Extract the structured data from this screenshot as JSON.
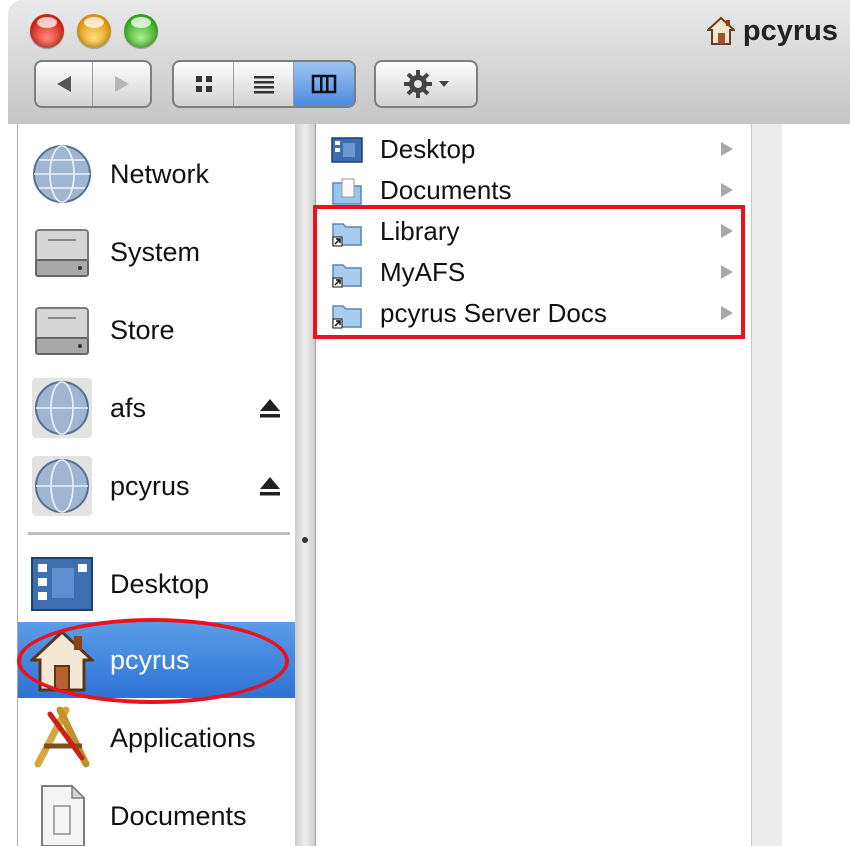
{
  "window": {
    "title": "pcyrus"
  },
  "toolbar": {
    "back_icon": "back-arrow-icon",
    "forward_icon": "forward-arrow-icon",
    "view_modes": [
      "icon-view",
      "list-view",
      "column-view"
    ],
    "active_view": "column-view",
    "action_icon": "gear-icon"
  },
  "sidebar": {
    "volumes": [
      {
        "label": "Network",
        "icon": "network-globe-icon",
        "eject": false
      },
      {
        "label": "System",
        "icon": "hard-drive-icon",
        "eject": false
      },
      {
        "label": "Store",
        "icon": "hard-drive-icon",
        "eject": false
      },
      {
        "label": "afs",
        "icon": "network-globe-icon",
        "eject": true
      },
      {
        "label": "pcyrus",
        "icon": "network-globe-icon",
        "eject": true
      }
    ],
    "places": [
      {
        "label": "Desktop",
        "icon": "desktop-icon"
      },
      {
        "label": "pcyrus",
        "icon": "home-icon",
        "selected": true
      },
      {
        "label": "Applications",
        "icon": "applications-icon"
      },
      {
        "label": "Documents",
        "icon": "document-icon"
      }
    ]
  },
  "column1": {
    "items": [
      {
        "label": "Desktop",
        "icon": "desktop-folder-icon"
      },
      {
        "label": "Documents",
        "icon": "documents-folder-icon"
      },
      {
        "label": "Library",
        "icon": "alias-folder-icon"
      },
      {
        "label": "MyAFS",
        "icon": "alias-folder-icon"
      },
      {
        "label": "pcyrus Server Docs",
        "icon": "alias-folder-icon"
      }
    ]
  },
  "colors": {
    "selection": "#3b7fd9",
    "highlight": "#e8131f",
    "close": "#d11f12",
    "minimize": "#e0940c",
    "zoom": "#36a81c"
  }
}
